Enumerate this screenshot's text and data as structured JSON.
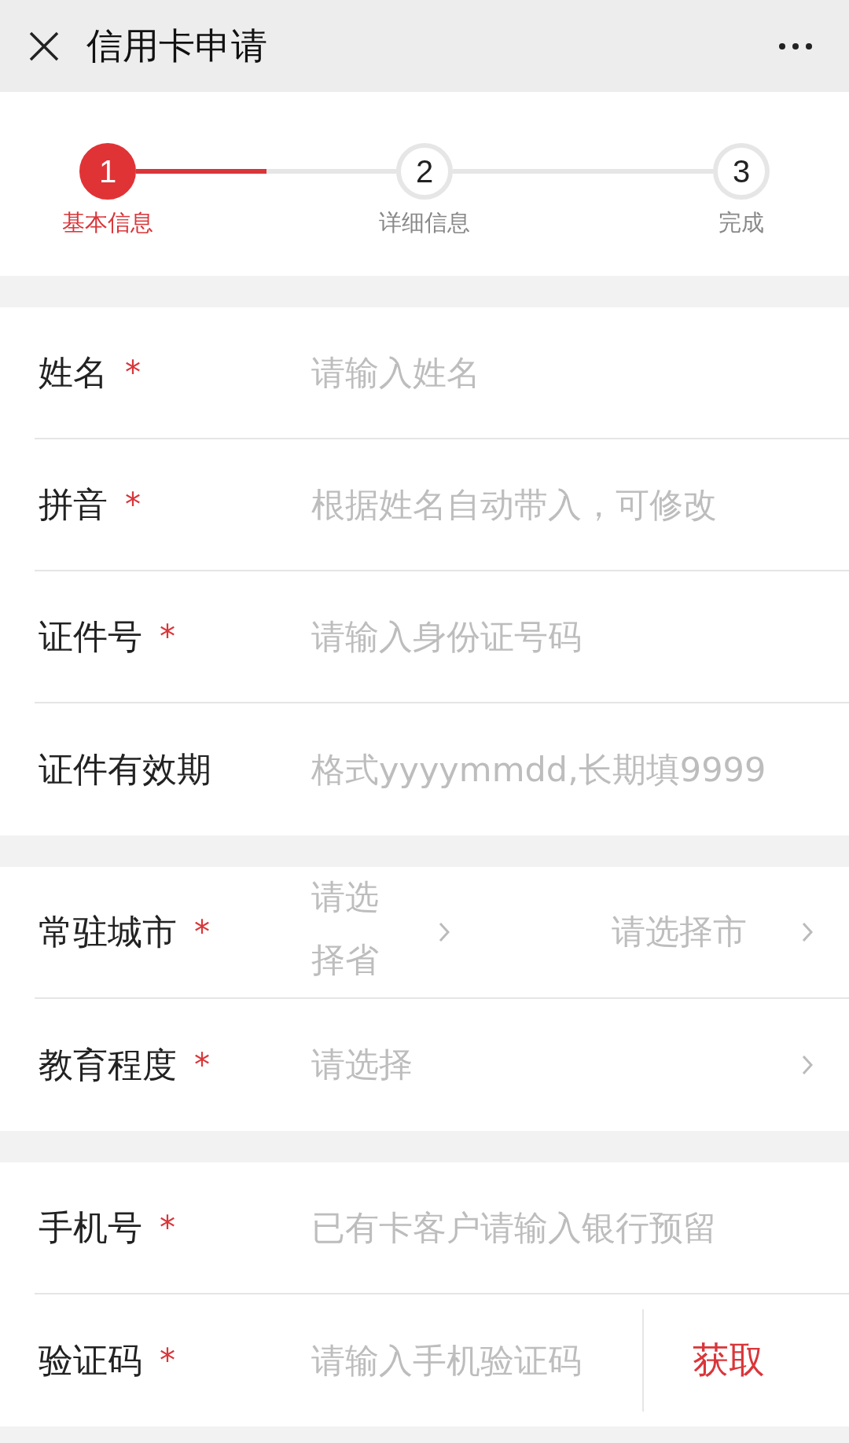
{
  "header": {
    "title": "信用卡申请"
  },
  "steps": [
    {
      "number": "1",
      "label": "基本信息",
      "selected": true
    },
    {
      "number": "2",
      "label": "详细信息",
      "selected": false
    },
    {
      "number": "3",
      "label": "完成",
      "selected": false
    }
  ],
  "connectors": [
    {
      "level": 0.5
    }
  ],
  "sections": [
    {
      "rows": [
        {
          "kind": "input",
          "label": "姓名",
          "required_mark": "*",
          "placeholder": "请输入姓名"
        },
        {
          "kind": "input",
          "label": "拼音",
          "required_mark": "*",
          "placeholder": "根据姓名自动带入，可修改"
        },
        {
          "kind": "input",
          "label": "证件号",
          "required_mark": "*",
          "placeholder": "请输入身份证号码"
        },
        {
          "kind": "input",
          "label": "证件有效期",
          "placeholder": "格式yyyymmdd,长期填9999"
        }
      ]
    },
    {
      "rows": [
        {
          "kind": "dual_select",
          "label": "常驻城市",
          "required_mark": "*",
          "placeholder": "请选择省",
          "placeholder_2": "请选择市"
        },
        {
          "kind": "select",
          "label": "教育程度",
          "required_mark": "*",
          "placeholder": "请选择"
        }
      ]
    },
    {
      "rows": [
        {
          "kind": "input",
          "label": "手机号",
          "required_mark": "*",
          "placeholder": "已有卡客户请输入银行预留"
        },
        {
          "kind": "code",
          "label": "验证码",
          "required_mark": "*",
          "placeholder": "请输入手机验证码",
          "button": "获取"
        }
      ]
    }
  ]
}
